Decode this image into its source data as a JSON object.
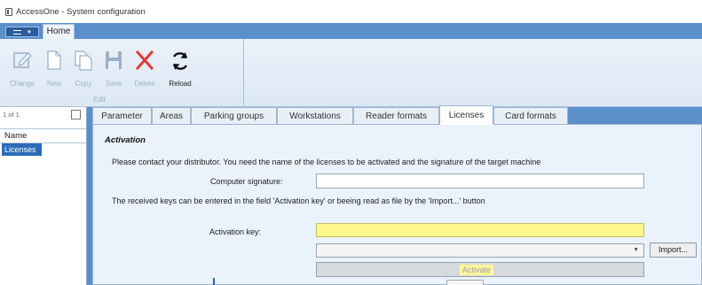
{
  "window": {
    "title": "AccessOne - System configuration"
  },
  "ribbon": {
    "tab_home": "Home",
    "buttons": {
      "change": "Change",
      "new": "New",
      "copy": "Copy",
      "save": "Save",
      "delete": "Delete",
      "reload": "Reload"
    },
    "group_label": "Edit"
  },
  "left_panel": {
    "count": "1 of 1",
    "column_header": "Name",
    "selected_item": "Licenses"
  },
  "tabs": [
    "Parameter",
    "Areas",
    "Parking groups",
    "Workstations",
    "Reader formats",
    "Licenses",
    "Card formats"
  ],
  "active_tab": "Licenses",
  "activation": {
    "heading": "Activation",
    "info_text_1": "Please contact your distributor. You need the name of the licenses to be activated and the signature of the target machine",
    "computer_signature_label": "Computer signature:",
    "computer_signature_value": "",
    "info_text_2": "The received keys can be entered in the field 'Activation key' or beeing read as file by the 'Import...' button",
    "activation_key_label": "Activation key:",
    "activation_key_value": "",
    "import_button": "Import...",
    "activate_button": "Activate"
  },
  "colors": {
    "ribbon_blue": "#5b8fc9",
    "delete_red": "#e03c31",
    "highlight_yellow": "#fff88a",
    "selection_blue": "#2d6bb7"
  }
}
